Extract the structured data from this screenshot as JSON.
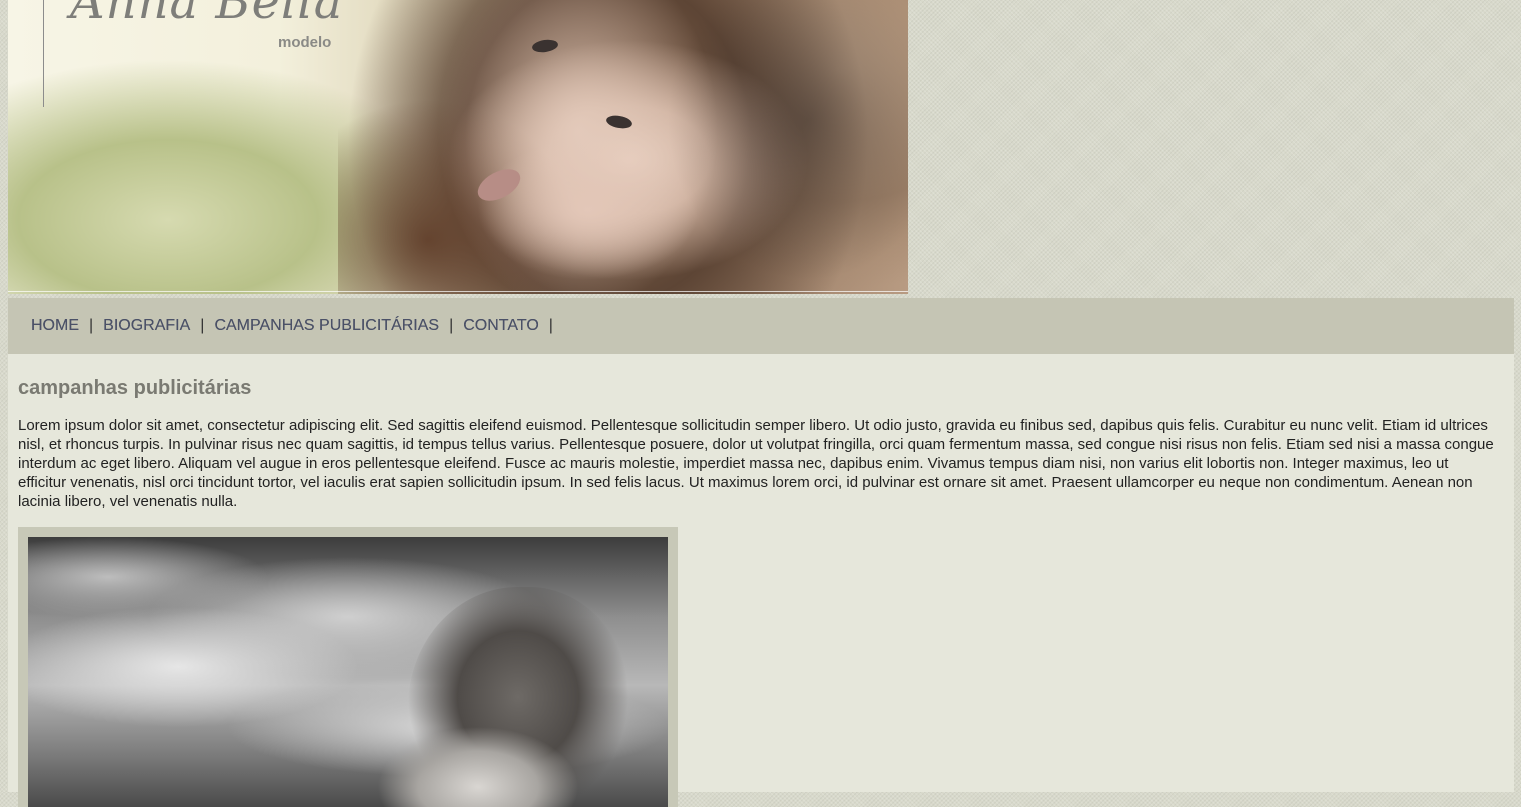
{
  "header": {
    "brand_name": "Anna Bella",
    "brand_subtitle": "modelo"
  },
  "nav": {
    "items": [
      {
        "label": "HOME"
      },
      {
        "label": "BIOGRAFIA"
      },
      {
        "label": "CAMPANHAS PUBLICITÁRIAS"
      },
      {
        "label": "CONTATO"
      }
    ],
    "separator": "|"
  },
  "content": {
    "title": "campanhas publicitárias",
    "body": "Lorem ipsum dolor sit amet, consectetur adipiscing elit. Sed sagittis eleifend euismod. Pellentesque sollicitudin semper libero. Ut odio justo, gravida eu finibus sed, dapibus quis felis. Curabitur eu nunc velit. Etiam id ultrices nisl, et rhoncus turpis. In pulvinar risus nec quam sagittis, id tempus tellus varius. Pellentesque posuere, dolor ut volutpat fringilla, orci quam fermentum massa, sed congue nisi risus non felis. Etiam sed nisi a massa congue interdum ac eget libero. Aliquam vel augue in eros pellentesque eleifend. Fusce ac mauris molestie, imperdiet massa nec, dapibus enim. Vivamus tempus diam nisi, non varius elit lobortis non. Integer maximus, leo ut efficitur venenatis, nisl orci tincidunt tortor, vel iaculis erat sapien sollicitudin ipsum. In sed felis lacus. Ut maximus lorem orci, id pulvinar est ornare sit amet. Praesent ullamcorper eu neque non condimentum. Aenean non lacinia libero, vel venenatis nulla."
  },
  "colors": {
    "nav_background": "#c5c5b4",
    "nav_link": "#4b5167",
    "content_background": "#e6e7db",
    "title": "#7a7a72"
  }
}
